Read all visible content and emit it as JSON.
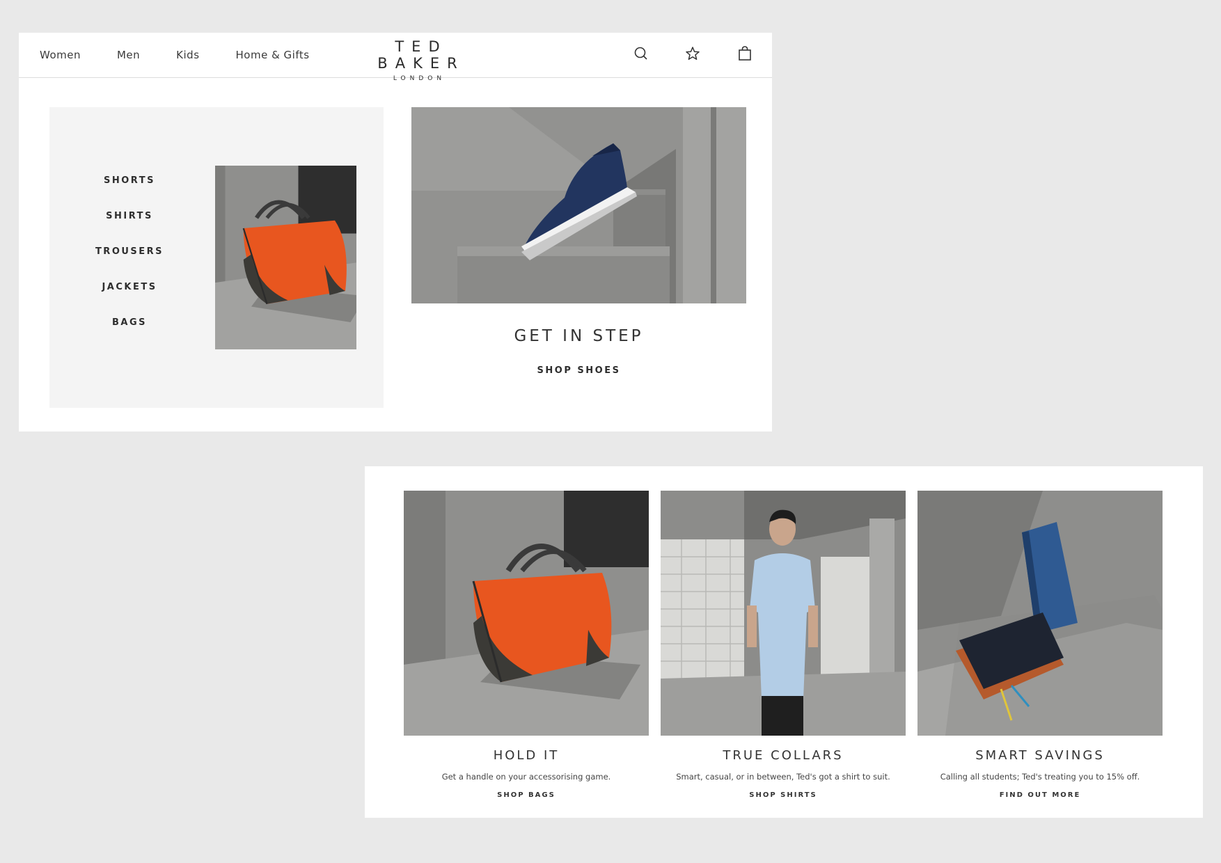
{
  "header": {
    "nav": [
      "Women",
      "Men",
      "Kids",
      "Home & Gifts"
    ],
    "logo": {
      "brand": "TED BAKER",
      "sub": "LONDON"
    },
    "icons": [
      "search-icon",
      "wishlist-star-icon",
      "shopping-bag-icon"
    ]
  },
  "menu": {
    "items": [
      "SHORTS",
      "SHIRTS",
      "TROUSERS",
      "JACKETS",
      "BAGS"
    ]
  },
  "hero": {
    "title": "GET IN STEP",
    "link": "SHOP SHOES"
  },
  "cards": [
    {
      "title": "HOLD IT",
      "desc": "Get a handle on your accessorising game.",
      "cta": "SHOP BAGS"
    },
    {
      "title": "TRUE COLLARS",
      "desc": "Smart, casual, or in between, Ted's got a shirt to suit.",
      "cta": "SHOP SHIRTS"
    },
    {
      "title": "SMART SAVINGS",
      "desc": "Calling all students; Ted's treating you to 15% off.",
      "cta": "FIND OUT MORE"
    }
  ],
  "colors": {
    "page_bg": "#e9e9e9",
    "panel_bg": "#ffffff",
    "menu_bg": "#f4f4f4",
    "bag_orange": "#e8561f",
    "shoe_navy": "#22355f",
    "text": "#333333"
  }
}
